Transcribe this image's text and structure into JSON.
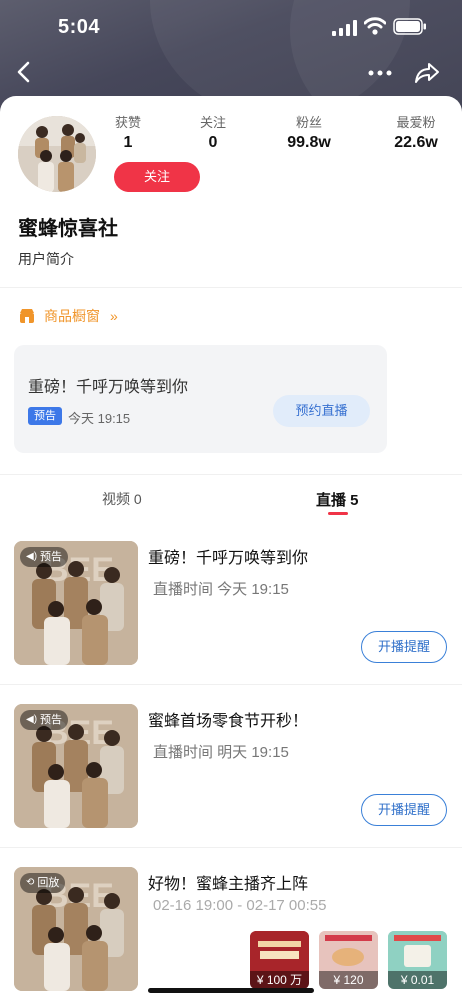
{
  "status_bar": {
    "time": "5:04"
  },
  "profile": {
    "name": "蜜蜂惊喜社",
    "intro": "用户简介",
    "follow_button": "关注",
    "stats": [
      {
        "label": "获赞",
        "value": "1"
      },
      {
        "label": "关注",
        "value": "0"
      },
      {
        "label": "粉丝",
        "value": "99.8w"
      },
      {
        "label": "最爱粉",
        "value": "22.6w"
      }
    ]
  },
  "shop_window": {
    "label": "商品橱窗",
    "chevron": "»"
  },
  "live_card": {
    "title": "重磅！千呼万唤等到你",
    "badge": "预告",
    "time": "今天 19:15",
    "button": "预约直播"
  },
  "tabs": [
    {
      "label": "视频 0",
      "active": false
    },
    {
      "label": "直播 5",
      "active": true
    }
  ],
  "items": [
    {
      "tag": "预告",
      "tag_icon": "speaker-icon",
      "title": "重磅！千呼万唤等到你",
      "subtitle": "直播时间  今天 19:15",
      "button": "开播提醒"
    },
    {
      "tag": "预告",
      "tag_icon": "speaker-icon",
      "title": "蜜蜂首场零食节开秒！",
      "subtitle": "直播时间  明天 19:15",
      "button": "开播提醒"
    },
    {
      "tag": "回放",
      "tag_icon": "replay-icon",
      "title": "好物！蜜蜂主播齐上阵",
      "subtitle": "02-16 19:00 - 02-17 00:55",
      "products": [
        {
          "price": "¥ 100 万",
          "color": "#a8252a"
        },
        {
          "price": "¥ 120",
          "color": "#d9a6a0"
        },
        {
          "price": "¥ 0.01",
          "color": "#7cc8b6"
        }
      ]
    }
  ],
  "colors": {
    "accent_red": "#f03447",
    "accent_orange": "#f0952a",
    "link_blue": "#2f6fc9"
  }
}
